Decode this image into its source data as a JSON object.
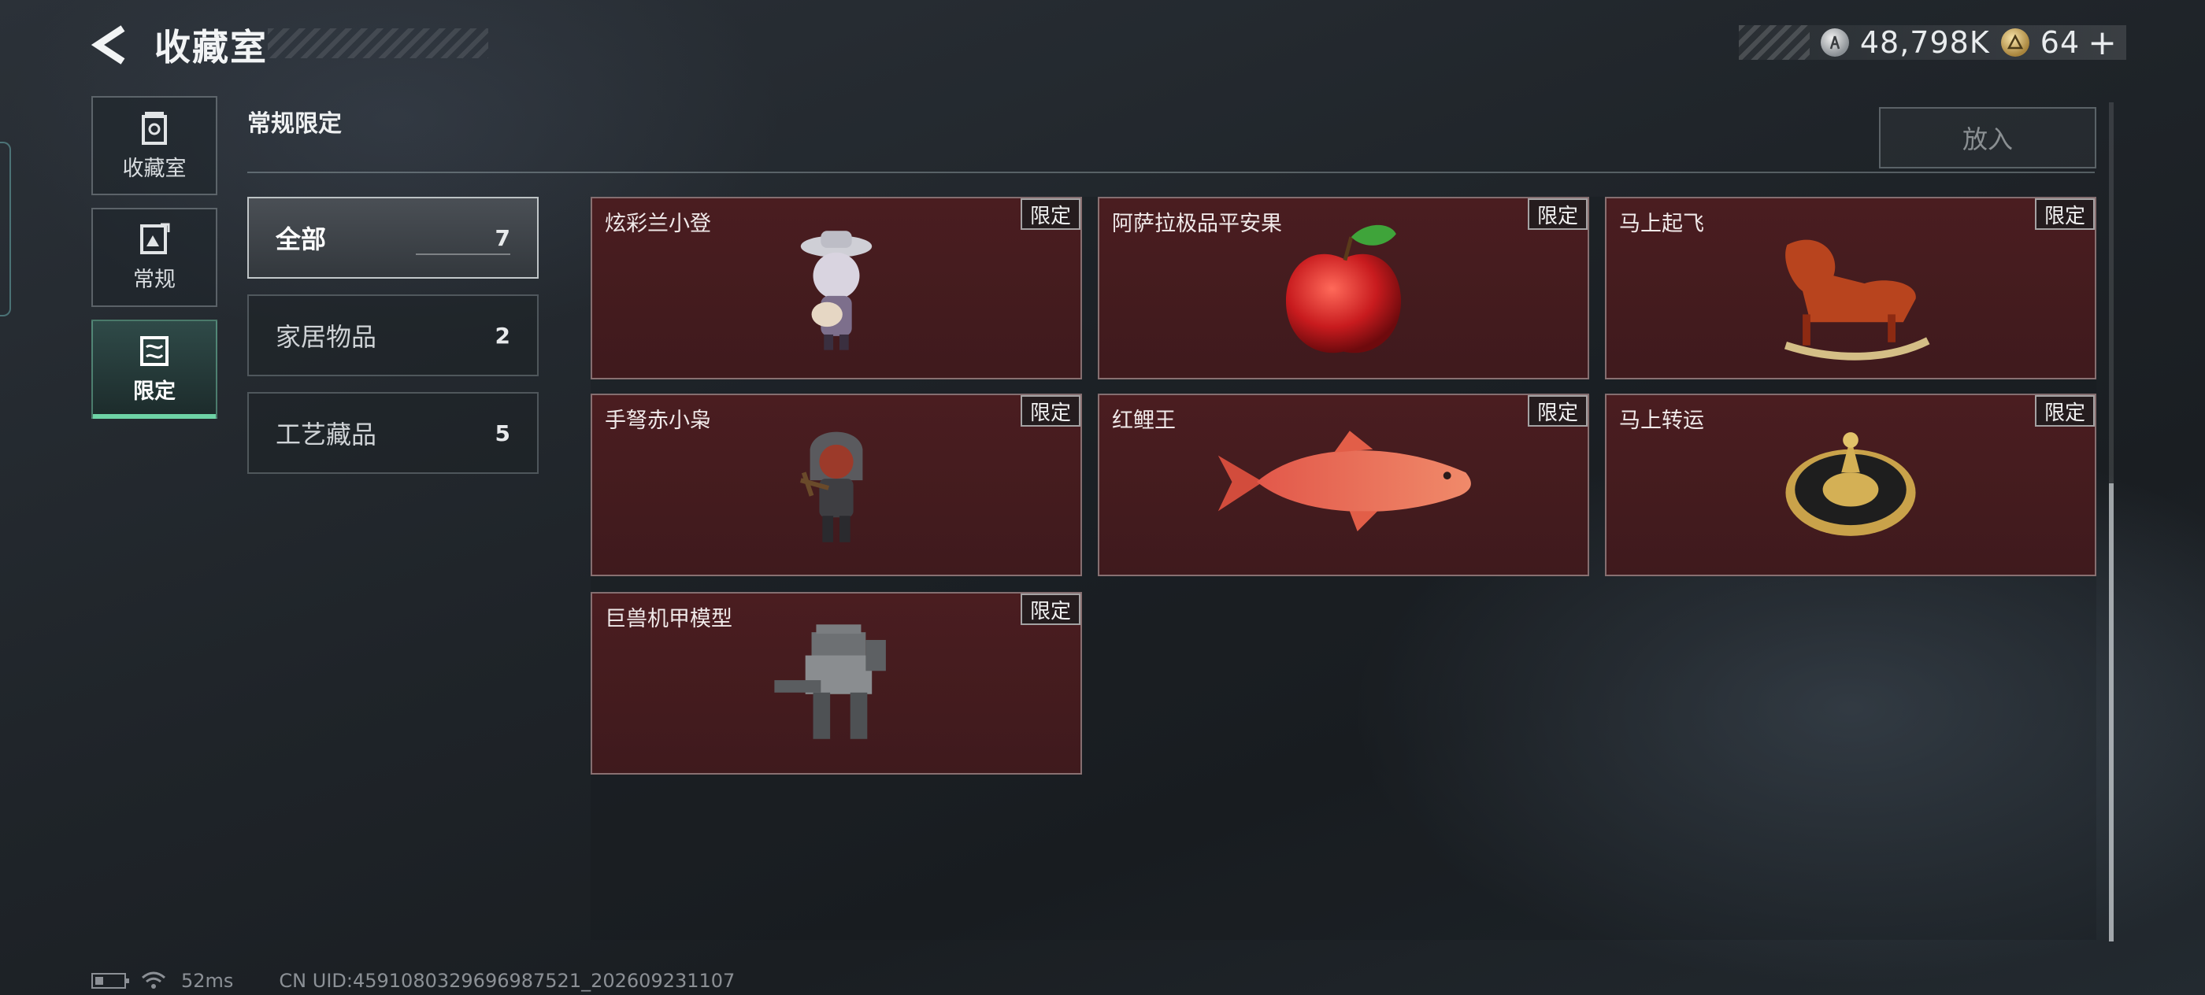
{
  "header": {
    "title": "收藏室",
    "currency": [
      {
        "icon": "silver-coin-icon",
        "value": "48,798K"
      },
      {
        "icon": "gold-token-icon",
        "value": "64"
      }
    ],
    "add_symbol": "+"
  },
  "nav": {
    "items": [
      {
        "label": "收藏室",
        "icon": "collection-room-icon"
      },
      {
        "label": "常规",
        "icon": "regular-icon"
      },
      {
        "label": "限定",
        "icon": "limited-icon",
        "active": true
      }
    ]
  },
  "section": {
    "title": "常规限定",
    "put_button": "放入"
  },
  "categories": [
    {
      "name": "全部",
      "count": "7",
      "active": true
    },
    {
      "name": "家居物品",
      "count": "2"
    },
    {
      "name": "工艺藏品",
      "count": "5"
    }
  ],
  "items": [
    {
      "name": "炫彩兰小登",
      "badge": "限定",
      "icon": "mariachi-figurine-icon"
    },
    {
      "name": "阿萨拉极品平安果",
      "badge": "限定",
      "icon": "red-apple-icon"
    },
    {
      "name": "马上起飞",
      "badge": "限定",
      "icon": "rocking-horse-icon"
    },
    {
      "name": "手弩赤小枭",
      "badge": "限定",
      "icon": "crossbow-figurine-icon"
    },
    {
      "name": "红鲤王",
      "badge": "限定",
      "icon": "red-carp-icon"
    },
    {
      "name": "马上转运",
      "badge": "限定",
      "icon": "golden-spinner-icon"
    },
    {
      "name": "巨兽机甲模型",
      "badge": "限定",
      "icon": "mech-model-icon"
    }
  ],
  "footer": {
    "ping": "52ms",
    "uid": "CN UID:4591080329696987521_202609231107"
  },
  "colors": {
    "accent": "#6ed3a6",
    "card_bg": "#451b1e"
  }
}
